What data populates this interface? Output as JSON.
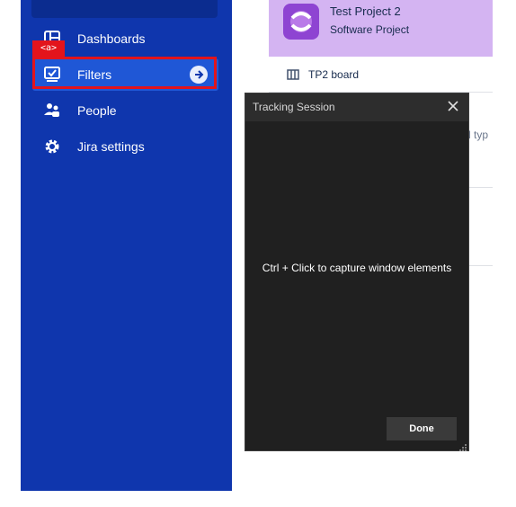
{
  "sidebar": {
    "items": [
      {
        "label": "Dashboards",
        "icon": "dashboard-icon"
      },
      {
        "label": "Filters",
        "icon": "filter-icon",
        "active": true
      },
      {
        "label": "People",
        "icon": "people-icon"
      },
      {
        "label": "Jira settings",
        "icon": "gear-icon"
      }
    ],
    "highlight_tag": "<a>"
  },
  "project": {
    "name": "Test Project 2",
    "type": "Software Project",
    "board": "TP2 board",
    "partial_text": "l typ"
  },
  "tracker": {
    "title": "Tracking Session",
    "message": "Ctrl + Click to capture window elements",
    "done_label": "Done"
  },
  "colors": {
    "sidebar_bg": "#0f36ad",
    "active_item": "#1f57d6",
    "highlight": "#e3141c",
    "project_card": "#d4b4f2",
    "tracker_bg": "#202020"
  }
}
